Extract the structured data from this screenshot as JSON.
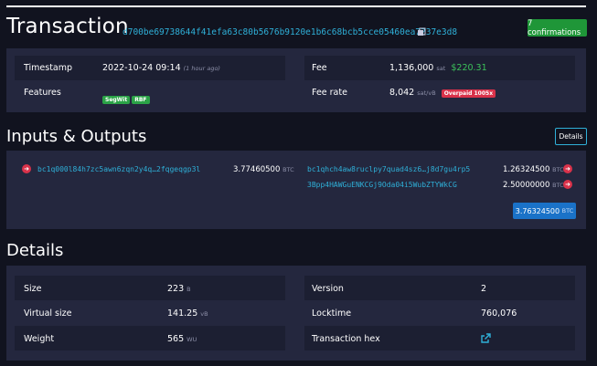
{
  "header": {
    "title": "Transaction",
    "txid": "d700be69738644f41efa63c80b5676b9120e1b6c68bcb5cce05460ea7237e3d8",
    "confirmations": "7 confirmations"
  },
  "overview": {
    "timestamp_label": "Timestamp",
    "timestamp_value": "2022-10-24 09:14",
    "timestamp_ago": "(1 hour ago)",
    "features_label": "Features",
    "feature_tags": [
      "SegWit",
      "RBF"
    ],
    "fee_label": "Fee",
    "fee_value": "1,136,000",
    "fee_unit": "sat",
    "fee_usd": "$220.31",
    "feerate_label": "Fee rate",
    "feerate_value": "8,042",
    "feerate_unit": "sat/vB",
    "feerate_badge": "Overpaid 1005x"
  },
  "io": {
    "title": "Inputs & Outputs",
    "details_button": "Details",
    "inputs": [
      {
        "address": "bc1q000l84h7zc5awn6zqn2y4q…2fqgeqgp3l",
        "amount": "3.77460500",
        "unit": "BTC"
      }
    ],
    "outputs": [
      {
        "address": "bc1qhch4aw8ruclpy7quad4sz6…j8d7gu4rp5",
        "amount": "1.26324500",
        "unit": "BTC"
      },
      {
        "address": "3Bpp4HAWGuENKCGj9Oda04i5WubZTYWkCG",
        "amount": "2.50000000",
        "unit": "BTC"
      }
    ],
    "total": "3.76324500",
    "total_unit": "BTC"
  },
  "details": {
    "title": "Details",
    "size_label": "Size",
    "size_value": "223",
    "size_unit": "B",
    "vsize_label": "Virtual size",
    "vsize_value": "141.25",
    "vsize_unit": "vB",
    "weight_label": "Weight",
    "weight_value": "565",
    "weight_unit": "WU",
    "version_label": "Version",
    "version_value": "2",
    "locktime_label": "Locktime",
    "locktime_value": "760,076",
    "hex_label": "Transaction hex"
  },
  "colors": {
    "accent": "#2fb0d8",
    "success": "#1f9638",
    "danger": "#d9324a",
    "primary": "#1a72c8"
  }
}
